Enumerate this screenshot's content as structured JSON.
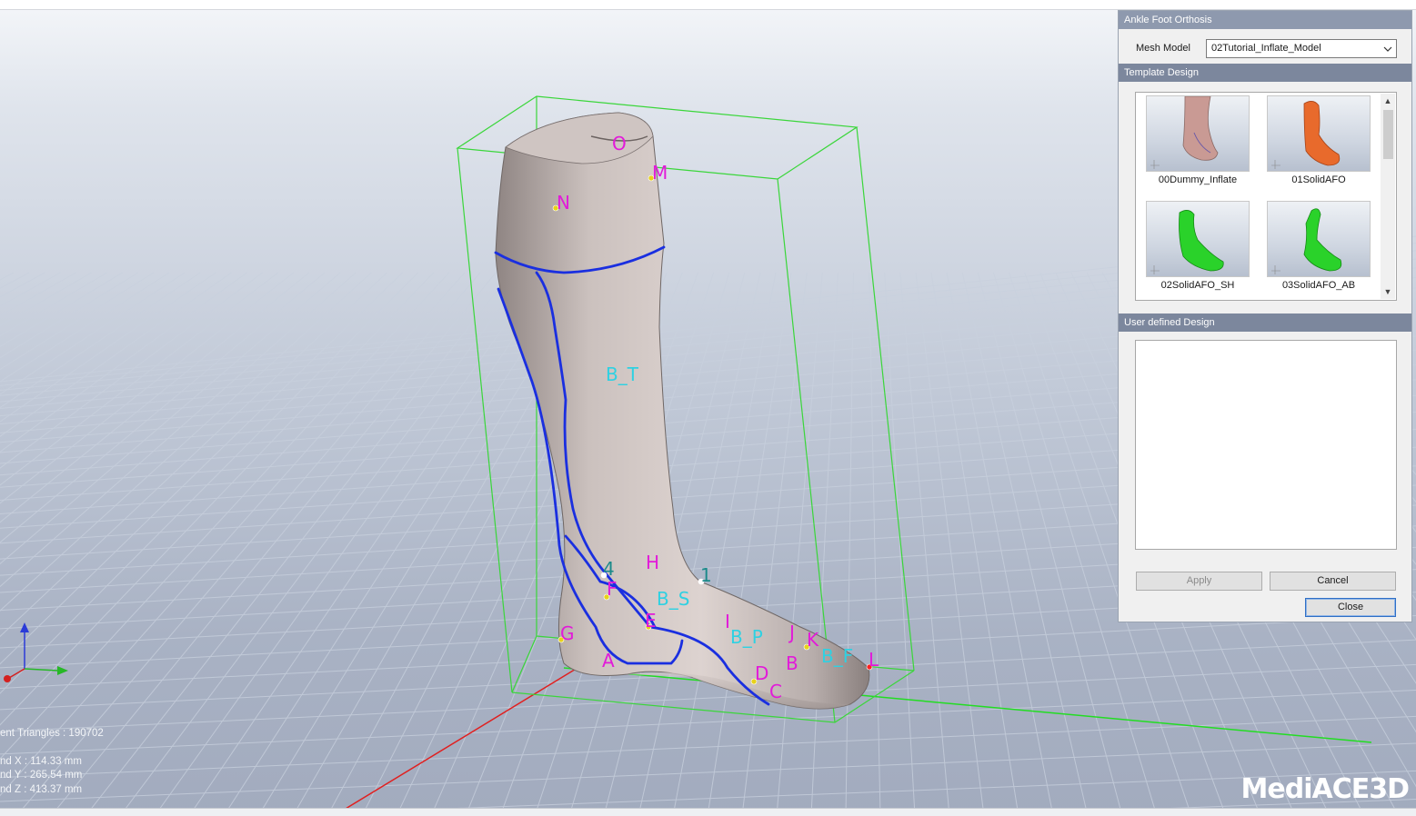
{
  "viewport": {
    "landmarks": [
      {
        "name": "O",
        "color": "magenta"
      },
      {
        "name": "M",
        "color": "magenta"
      },
      {
        "name": "N",
        "color": "magenta"
      },
      {
        "name": "B_T",
        "color": "cyan"
      },
      {
        "name": "4",
        "color": "teal"
      },
      {
        "name": "H",
        "color": "magenta"
      },
      {
        "name": "1",
        "color": "teal"
      },
      {
        "name": "F",
        "color": "magenta"
      },
      {
        "name": "B_S",
        "color": "cyan"
      },
      {
        "name": "G",
        "color": "magenta"
      },
      {
        "name": "E",
        "color": "magenta"
      },
      {
        "name": "I",
        "color": "magenta"
      },
      {
        "name": "B_P",
        "color": "cyan"
      },
      {
        "name": "J",
        "color": "magenta"
      },
      {
        "name": "K",
        "color": "magenta"
      },
      {
        "name": "B_F",
        "color": "cyan"
      },
      {
        "name": "L",
        "color": "magenta"
      },
      {
        "name": "A",
        "color": "magenta"
      },
      {
        "name": "B",
        "color": "magenta"
      },
      {
        "name": "D",
        "color": "magenta"
      },
      {
        "name": "C",
        "color": "magenta"
      }
    ],
    "stats": {
      "triangles": "ent Triangles : 190702",
      "bound_x": "nd X : 114.33 mm",
      "bound_y": "nd Y : 265.54 mm",
      "bound_z": "nd Z : 413.37 mm"
    },
    "logo": "MediACE3D",
    "colors": {
      "landmark_magenta": "#e21ad9",
      "landmark_cyan": "#2fd1e2",
      "bounding_box": "#3ad63a",
      "trim_line": "#1a2fe0"
    }
  },
  "panel": {
    "title": "Ankle Foot Orthosis",
    "mesh_model_label": "Mesh Model",
    "mesh_model_value": "02Tutorial_Inflate_Model",
    "template_design_label": "Template Design",
    "templates": [
      {
        "name": "00Dummy_Inflate",
        "icon": "leg-skin-thumbnail"
      },
      {
        "name": "01SolidAFO",
        "icon": "orange-afo-thumbnail"
      },
      {
        "name": "02SolidAFO_SH",
        "icon": "green-afo-short-thumbnail"
      },
      {
        "name": "03SolidAFO_AB",
        "icon": "green-afo-ab-thumbnail"
      }
    ],
    "user_defined_label": "User defined Design",
    "buttons": {
      "apply": "Apply",
      "cancel": "Cancel",
      "close": "Close"
    }
  }
}
